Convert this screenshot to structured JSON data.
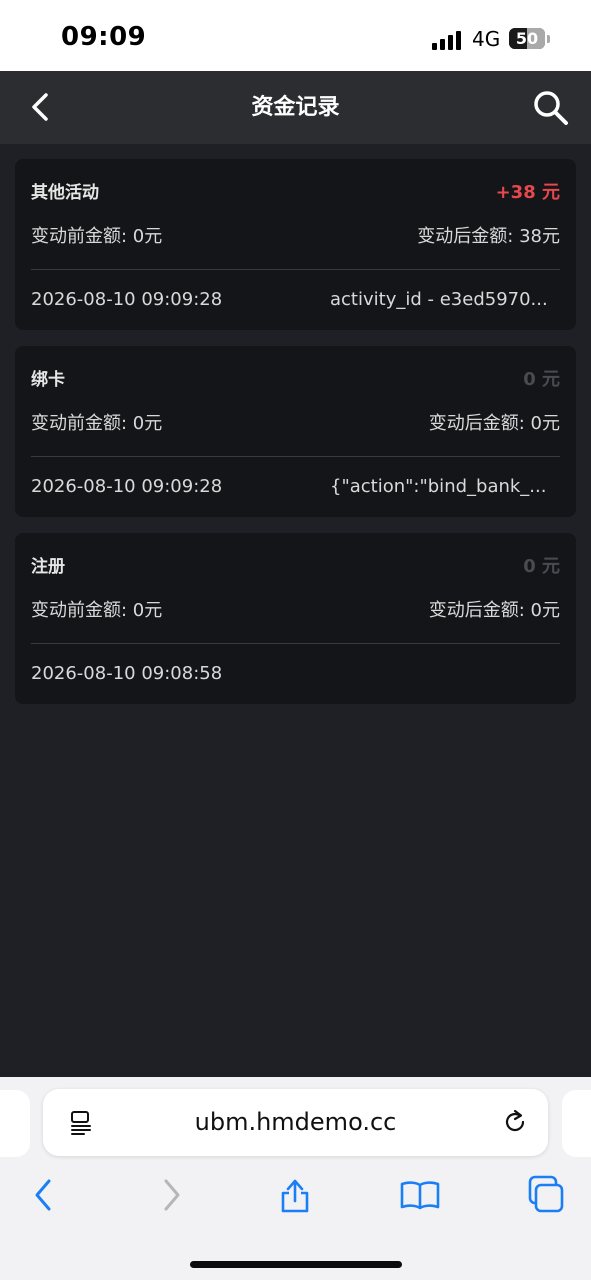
{
  "status": {
    "time": "09:09",
    "network": "4G",
    "battery": "50",
    "battery_level": 0.5
  },
  "header": {
    "title": "资金记录"
  },
  "records": [
    {
      "type": "其他活动",
      "amount": "+38 元",
      "positive": true,
      "before": "变动前金额: 0元",
      "after": "变动后金额: 38元",
      "time": "2026-08-10 09:09:28",
      "note": "activity_id - e3ed5970..."
    },
    {
      "type": "绑卡",
      "amount": "0 元",
      "positive": false,
      "before": "变动前金额: 0元",
      "after": "变动后金额: 0元",
      "time": "2026-08-10 09:09:28",
      "note": "{\"action\":\"bind_bank_..."
    },
    {
      "type": "注册",
      "amount": "0 元",
      "positive": false,
      "before": "变动前金额: 0元",
      "after": "变动后金额: 0元",
      "time": "2026-08-10 09:08:58",
      "note": ""
    }
  ],
  "browser": {
    "url": "ubm.hmdemo.cc"
  },
  "icons": [
    "back-arrow-icon",
    "search-icon",
    "reader-mode-icon",
    "reload-icon",
    "browser-back-icon",
    "browser-forward-icon",
    "share-icon",
    "bookmarks-icon",
    "tabs-icon",
    "signal-icon"
  ],
  "colors": {
    "accent_positive": "#e5484d",
    "zero_amount": "#4a4b50",
    "background": "#1f2025",
    "card": "#141519",
    "header": "#2c2d31",
    "link_blue": "#1a7ff5"
  }
}
